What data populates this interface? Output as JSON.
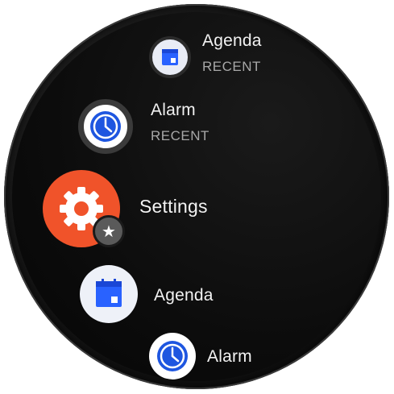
{
  "colors": {
    "settings_accent": "#f0532a",
    "calendar_blue": "#2962ff",
    "alarm_blue": "#1e56e0",
    "text_primary": "#f2f2f2",
    "text_secondary": "#a8a8a8",
    "screen_bg": "#0c0c0c"
  },
  "apps": [
    {
      "label": "Agenda",
      "sub": "RECENT",
      "icon": "calendar-icon",
      "partial": true
    },
    {
      "label": "Alarm",
      "sub": "RECENT",
      "icon": "clock-icon"
    },
    {
      "label": "Settings",
      "icon": "gear-icon",
      "badge_icon": "star-icon",
      "badge_text": "★",
      "selected": true
    },
    {
      "label": "Agenda",
      "icon": "calendar-icon"
    },
    {
      "label": "Alarm",
      "icon": "clock-icon",
      "partial": true
    }
  ]
}
